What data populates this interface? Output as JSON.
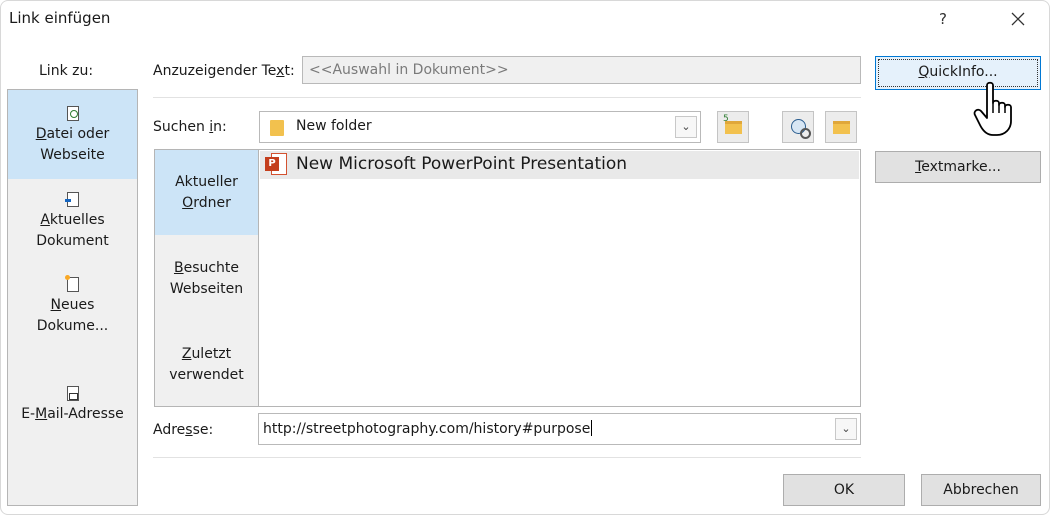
{
  "window": {
    "title": "Link einfügen",
    "help": "?",
    "close": "✕"
  },
  "link_to": {
    "header": "Link zu:",
    "items": [
      {
        "pre": "",
        "ul": "D",
        "post": "atei oder",
        "line2": "Webseite",
        "icon": "file-web-icon",
        "selected": true
      },
      {
        "pre": "",
        "ul": "A",
        "post": "ktuelles",
        "line2": "Dokument",
        "icon": "current-document-icon",
        "selected": false
      },
      {
        "pre": "",
        "ul": "N",
        "post": "eues",
        "line2": "Dokume...",
        "icon": "new-document-icon",
        "selected": false
      },
      {
        "pre": "E-",
        "ul": "M",
        "post": "ail-Adresse",
        "line2": "",
        "icon": "email-address-icon",
        "selected": false
      }
    ]
  },
  "display_text": {
    "label_pre": "Anzuzeigender Te",
    "label_ul": "x",
    "label_post": "t:",
    "value": "<<Auswahl in Dokument>>"
  },
  "search_in": {
    "label_pre": "Suchen ",
    "label_ul": "i",
    "label_post": "n:",
    "value": "New folder"
  },
  "tools": {
    "up_folder_number": "5"
  },
  "sub_nav": [
    {
      "line1": "Aktueller",
      "l2_ul": "O",
      "l2_rest": "rdner",
      "l1_ul": "",
      "l1_rest": "",
      "selected": true
    },
    {
      "line1": "",
      "l1_ul": "B",
      "l1_rest": "esuchte",
      "l2_ul": "",
      "l2_rest": "Webseiten",
      "selected": false
    },
    {
      "line1": "",
      "l1_ul": "Z",
      "l1_rest": "uletzt",
      "l2_ul": "",
      "l2_rest": "verwendet",
      "selected": false
    }
  ],
  "files": [
    {
      "name": "New Microsoft PowerPoint Presentation",
      "icon": "powerpoint-file-icon",
      "icon_letter": "P"
    }
  ],
  "address": {
    "label_pre": "Adre",
    "label_ul": "s",
    "label_post": "se:",
    "value": "http://streetphotography.com/history#purpose"
  },
  "buttons": {
    "quickinfo_ul": "Q",
    "quickinfo_rest": "uickInfo...",
    "bookmark_ul": "T",
    "bookmark_rest": "extmarke...",
    "ok": "OK",
    "cancel": "Abbrechen"
  }
}
